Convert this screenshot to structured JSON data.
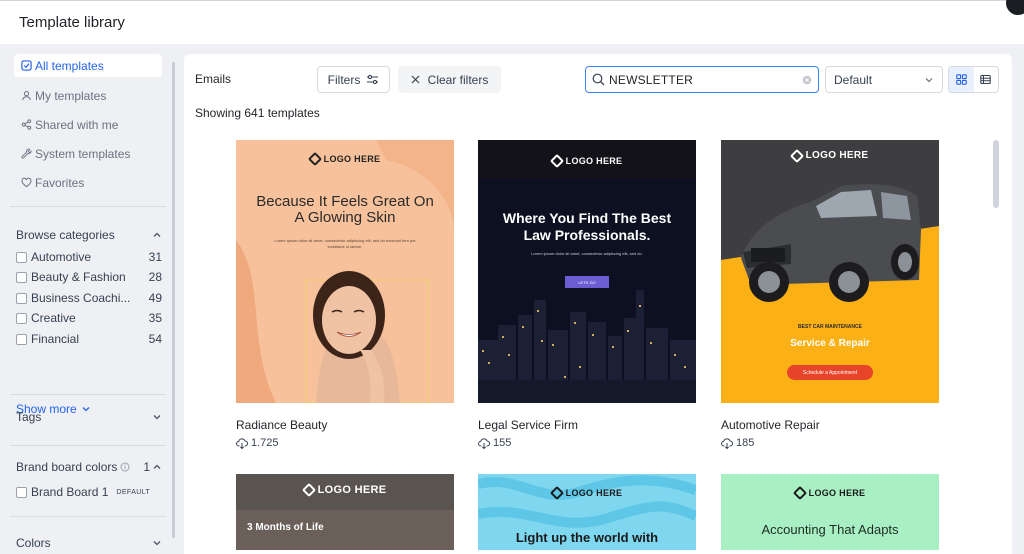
{
  "header": {
    "title": "Template library"
  },
  "nav": {
    "all_templates": "All templates",
    "my_templates": "My templates",
    "shared_with_me": "Shared with me",
    "system_templates": "System templates",
    "favorites": "Favorites"
  },
  "categories": {
    "heading": "Browse categories",
    "items": [
      {
        "name": "Automotive",
        "count": "31"
      },
      {
        "name": "Beauty & Fashion",
        "count": "28"
      },
      {
        "name": "Business Coachi...",
        "count": "49"
      },
      {
        "name": "Creative",
        "count": "35"
      },
      {
        "name": "Financial",
        "count": "54"
      }
    ],
    "show_more": "Show more"
  },
  "tags": {
    "heading": "Tags"
  },
  "brand": {
    "heading": "Brand board colors",
    "count": "1",
    "item": "Brand Board 1",
    "badge": "DEFAULT"
  },
  "colors": {
    "heading": "Colors"
  },
  "toolbar": {
    "section": "Emails",
    "filters": "Filters",
    "clear_filters": "Clear filters",
    "search_value": "NEWSLETTER",
    "sort_value": "Default"
  },
  "results": {
    "showing": "Showing 641 templates"
  },
  "cards": [
    {
      "title": "Radiance Beauty",
      "downloads": "1.725",
      "logo": "LOGO HERE",
      "headline": "Because It Feels Great On A Glowing Skin",
      "body": "Lorem ipsum dolor sit amet, consectetur adipiscing elit, sed do eiusmod tem por incididunt ut labore."
    },
    {
      "title": "Legal Service Firm",
      "downloads": "155",
      "logo": "LOGO HERE",
      "headline": "Where You Find The Best Law Professionals.",
      "body": "Lorem ipsum dolor sit amet, consectetur adipiscing elit, sed do.",
      "cta": "LETS GO"
    },
    {
      "title": "Automotive Repair",
      "downloads": "185",
      "logo": "LOGO HERE",
      "kicker": "BEST CAR MAINTENANCE",
      "headline": "Service & Repair",
      "cta": "Schedule a Appointment"
    }
  ],
  "cards_row2": [
    {
      "logo": "LOGO HERE",
      "headline": "3 Months of Life"
    },
    {
      "logo": "LOGO HERE",
      "headline": "Light up the world with"
    },
    {
      "logo": "LOGO HERE",
      "headline": "Accounting That Adapts"
    }
  ]
}
